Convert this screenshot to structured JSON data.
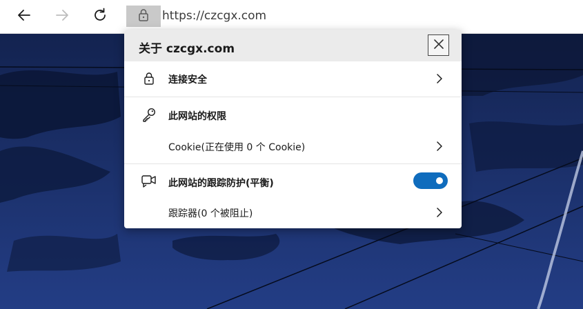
{
  "browser": {
    "url": "https://czcgx.com",
    "icons": {
      "back": "back-arrow-icon",
      "forward": "forward-arrow-icon",
      "refresh": "refresh-icon",
      "site_info": "lock-icon"
    }
  },
  "site_info_popup": {
    "title": "关于 czcgx.com",
    "close_icon": "close-icon",
    "connection": {
      "label": "连接安全",
      "icon": "lock-icon"
    },
    "permissions": {
      "heading": "此网站的权限",
      "icon": "key-icon",
      "cookie_label": "Cookie(正在使用 0 个 Cookie)"
    },
    "tracking": {
      "label": "此网站的跟踪防护(平衡)",
      "icon": "tracking-prevention-icon",
      "enabled": true,
      "trackers_label": "跟踪器(0 个被阻止)"
    }
  },
  "colors": {
    "toggle_on": "#0f6cbd",
    "popup_header": "#ebebeb",
    "lock_button": "#c9c9c9",
    "scene_sky": "#16285a"
  }
}
